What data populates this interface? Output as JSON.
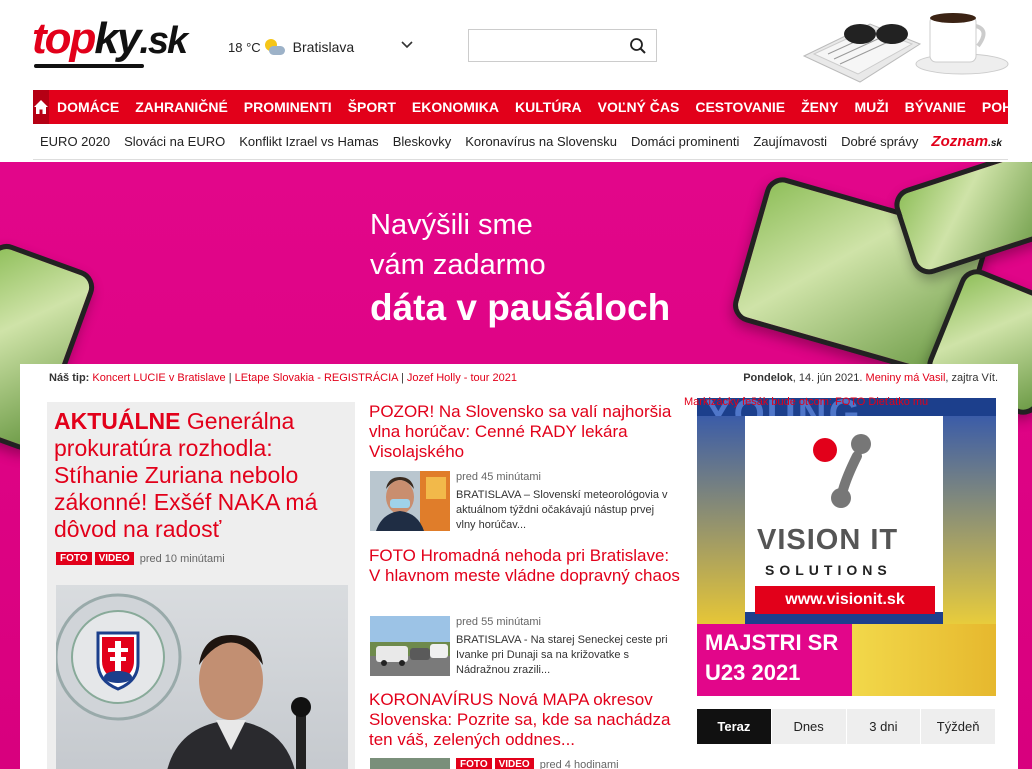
{
  "header": {
    "logo": {
      "part1": "top",
      "part2": "ky",
      "part3": ".sk"
    },
    "weather": {
      "temperature": "18 °C",
      "city": "Bratislava"
    },
    "search": {
      "placeholder": "",
      "value": ""
    }
  },
  "nav": {
    "items": [
      "DOMÁCE",
      "ZAHRANIČNÉ",
      "PROMINENTI",
      "ŠPORT",
      "EKONOMIKA",
      "KULTÚRA",
      "VOĽNÝ ČAS",
      "CESTOVANIE",
      "ŽENY",
      "MUŽI",
      "BÝVANIE",
      "POHODO"
    ]
  },
  "subnav": {
    "items": [
      "EURO 2020",
      "Slováci na EURO",
      "Konflikt Izrael vs Hamas",
      "Bleskovky",
      "Koronavírus na Slovensku",
      "Domáci prominenti",
      "Zaujímavosti",
      "Dobré správy"
    ],
    "partner": {
      "name": "Zoznam",
      "suffix": ".sk"
    }
  },
  "banner": {
    "line1": "Navýšili sme",
    "line2": "vám zadarmo",
    "line3": "dáta v paušáloch"
  },
  "tip": {
    "label": "Náš tip:",
    "links": [
      "Koncert LUCIE v Bratislave",
      "LEtape Slovakia - REGISTRÁCIA",
      "Jozef Holly - tour 2021"
    ],
    "separator": "|"
  },
  "date": {
    "day": "Pondelok",
    "date": ", 14. jún 2021.",
    "nameday_link": "Meniny má Vasil",
    "tomorrow": ", zajtra Vít."
  },
  "main_article": {
    "title_bold": "AKTUÁLNE",
    "title": " Generálna prokuratúra rozhodla: Stíhanie Zuriana nebolo zákonné! Exšéf NAKA má dôvod na radosť",
    "tags": [
      "FOTO",
      "VIDEO"
    ],
    "time": "pred 10 minútami"
  },
  "articles": [
    {
      "title": "POZOR! Na Slovensko sa valí najhoršia vlna horúčav: Cenné RADY lekára Visolajského",
      "meta": "pred 45 minútami",
      "desc": "BRATISLAVA – Slovenskí meteorológovia v aktuálnom týždni očakávajú nástup prvej vlny horúčav..."
    },
    {
      "title": "FOTO Hromadná nehoda pri Bratislave: V hlavnom meste vládne dopravný chaos",
      "meta": "pred 55 minútami",
      "desc": "BRATISLAVA - Na starej Seneckej ceste pri Ivanke pri Dunaji sa na križovatke s Nádražnou zrazili..."
    },
    {
      "title": "KORONAVÍRUS Nová MAPA okresov Slovenska: Pozrite sa, kde sa nachádza ten váš, zelených oddnes...",
      "tags": [
        "FOTO",
        "VIDEO"
      ],
      "meta": "pred 4 hodinami"
    }
  ],
  "ad": {
    "heading": "YOUNG ANGELS",
    "brand": "VISION IT",
    "sub": "SOLUTIONS",
    "url": "www.visionit.sk",
    "caption1": "MAJSTRI SR",
    "caption2": "U23 2021"
  },
  "tabs": {
    "items": [
      "Teraz",
      "Dnes",
      "3 dni",
      "Týždeň"
    ],
    "active": 0,
    "first_item": "Markizácky fešák bude otcom: FOTO Dieťatko mu"
  }
}
